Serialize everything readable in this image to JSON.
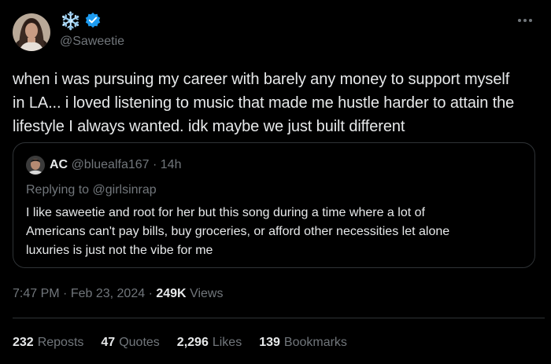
{
  "tweet": {
    "author": {
      "display_name_emoji": "❄️",
      "verified_icon": "verified-badge-icon",
      "handle": "@Saweetie"
    },
    "text_lines": [
      "when i was pursuing my career with barely any money to support myself",
      "in LA... i loved listening to music that made me hustle harder to attain the",
      "lifestyle I always wanted. idk maybe we just built different"
    ],
    "quoted": {
      "name": "AC",
      "handle": "@bluealfa167",
      "separator": "·",
      "time": "14h",
      "replying_to": "Replying to @girlsinrap",
      "text_lines": [
        "I like saweetie and root for her but this song during a time where a lot of",
        "Americans can't pay bills, buy groceries, or afford other necessities let alone",
        "luxuries is just not the vibe for me"
      ]
    },
    "meta": {
      "time": "7:47 PM",
      "sep1": "·",
      "date": "Feb 23, 2024",
      "sep2": "·",
      "views_count": "249K",
      "views_label": "Views"
    },
    "stats": {
      "reposts_count": "232",
      "reposts_label": "Reposts",
      "quotes_count": "47",
      "quotes_label": "Quotes",
      "likes_count": "2,296",
      "likes_label": "Likes",
      "bookmarks_count": "139",
      "bookmarks_label": "Bookmarks"
    },
    "colors": {
      "background": "#000000",
      "text": "#e7e9ea",
      "secondary": "#71767b",
      "border": "#2f3336",
      "verified": "#1d9bf0"
    }
  }
}
